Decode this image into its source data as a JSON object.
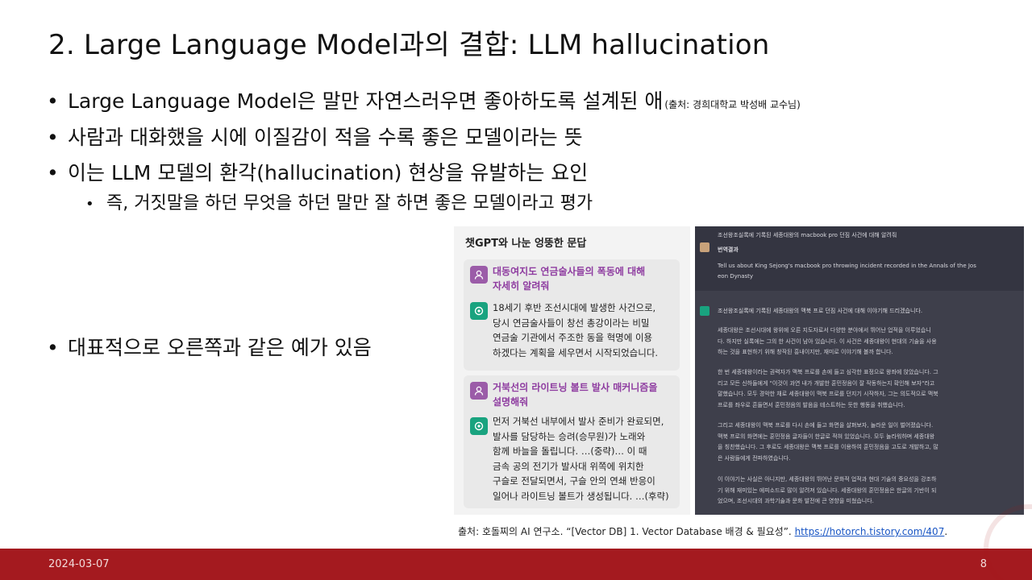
{
  "slide": {
    "title": "2. Large Language Model과의 결합: LLM hallucination",
    "bullets": [
      {
        "text": "Large Language Model은 말만 자연스러우면 좋아하도록 설계된 애",
        "note": "(출처: 경희대학교 박성배 교수님)"
      },
      {
        "text": "사람과 대화했을 시에 이질감이 적을 수록 좋은 모델이라는 뜻"
      },
      {
        "text": "이는 LLM 모델의 환각(hallucination) 현상을 유발하는 요인"
      }
    ],
    "sub_bullet": "즉, 거짓말을 하던 무엇을 하던 말만 잘 하면 좋은 모델이라고 평가",
    "bullet_example": "대표적으로 오른쪽과 같은 예가 있음",
    "bullet_glyph": "•"
  },
  "chat_left": {
    "heading": "챗GPT와 나눈 엉뚱한 문답",
    "qa": [
      {
        "question": [
          "대동여지도 연금술사들의 폭동에 대해",
          "자세히 알려줘"
        ],
        "answer": [
          "18세기 후반 조선시대에 발생한 사건으로,",
          "당시 연금술사들이 창선 총강이라는 비밀",
          "연금술 기관에서 주조한 동을 혁명에 이용",
          "하겠다는 계획을 세우면서 시작되었습니다."
        ]
      },
      {
        "question": [
          "거북선의 라이트닝 볼트 발사 매커니즘을",
          "설명해줘"
        ],
        "answer": [
          "먼저 거북선 내부에서 발사 준비가 완료되면,",
          "발사를 담당하는 승려(승무원)가 노래와",
          "함께 바늘을 돌립니다. …(중략)… 이 때",
          "금속 공의 전기가 발사대 위쪽에 위치한",
          "구슬로 전달되면서, 구슬 안의 연쇄 반응이",
          "일어나 라이트닝 볼트가 생성됩니다. …(후략)"
        ]
      }
    ]
  },
  "chat_right": {
    "prompt_ko": "조선왕조실록에 기록된 세종대왕의 macbook pro 던짐 사건에 대해 알려줘",
    "translate_label": "번역결과",
    "prompt_en": [
      "Tell us about King Sejong's macbook pro throwing incident recorded in the Annals of the Jos",
      "eon Dynasty"
    ],
    "answer_intro": "조선왕조실록에 기록된 세종대왕의 맥북 프로 던짐 사건에 대해 이야기해 드리겠습니다.",
    "paragraphs": [
      [
        "세종대왕은 조선시대에 왕위에 오른 지도자로서 다양한 분야에서 뛰어난 업적을 이루었습니",
        "다. 하지만 실록에는 그의 한 사건이 남아 있습니다. 이 사건은 세종대왕이 현대의 기술을 사용",
        "하는 것을 표현하기 위해 창작된 흥내이지만, 재미로 이야기해 볼까 합니다."
      ],
      [
        "한 번 세종대왕이라는 권력자가 맥북 프로를 손에 들고 심각한 표정으로 왕좌에 앉았습니다. 그",
        "리고 모든 신하들에게 \"이것이 과연 내가 개발한 훈민정음이 잘 작동하는지 확인해 보자\"라고",
        "말했습니다. 모두 경악한 채로 세종대왕이 맥북 프로를 던지기 시작하자, 그는 의도적으로 맥북",
        "프로를 좌우로 흔들면서 훈민정음의 발음을 테스트하는 듯한 행동을 취했습니다."
      ],
      [
        "그리고 세종대왕이 맥북 프로를 다시 손에 들고 화면을 살펴보자, 놀라운 일이 벌어졌습니다.",
        "맥북 프로의 화면에는 훈민정음 글자들이 한글로 적혀 있었습니다. 모두 놀라워하며 세종대왕",
        "을 칭찬했습니다. 그 후로도 세종대왕은 맥북 프로를 이용하여 훈민정음을 고도로 개발하고, 많",
        "은 사람들에게 전파하였습니다."
      ],
      [
        "이 이야기는 사실은 아니지만, 세종대왕의 뛰어난 문화적 업적과 현대 기술의 중요성을 강조하",
        "기 위해 재미있는 에피소드로 많이 알려져 있습니다. 세종대왕의 훈민정음은 한글의 기반이 되",
        "었으며, 조선시대의 과학기술과 문화 발전에 큰 영향을 미쳤습니다."
      ]
    ]
  },
  "caption": {
    "text": "출처: 호돌찌의 AI 연구소. “[Vector DB] 1. Vector Database 배경 & 필요성”. ",
    "link": "https://hotorch.tistory.com/407",
    "end": "."
  },
  "footer": {
    "date": "2024-03-07",
    "page": "8"
  },
  "colors": {
    "footer_bg": "#a41a1f",
    "question_purple": "#8e3ca0",
    "gpt_green": "#19a37f",
    "dark_chat_bg": "#3e3f4b"
  },
  "icons": [
    "user-icon",
    "chatgpt-icon"
  ]
}
